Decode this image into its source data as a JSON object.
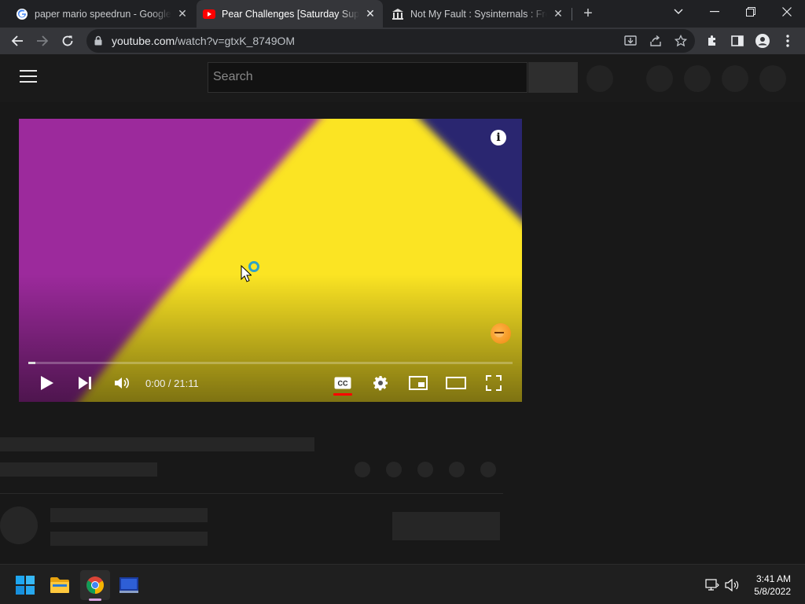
{
  "browser": {
    "tabs": [
      {
        "title": "paper mario speedrun - Google Search",
        "favicon": "google-icon",
        "active": false
      },
      {
        "title": "Pear Challenges [Saturday Supercut]",
        "favicon": "youtube-icon",
        "active": true
      },
      {
        "title": "Not My Fault : Sysinternals : Free Download",
        "favicon": "archive-icon",
        "active": false
      }
    ],
    "url_host": "youtube.com",
    "url_path": "/watch?v=gtxK_8749OM"
  },
  "youtube": {
    "search_placeholder": "Search",
    "player": {
      "timecode": "0:00 / 21:11",
      "progress_fraction": 0.015
    }
  },
  "taskbar": {
    "time": "3:41 AM",
    "date": "5/8/2022"
  },
  "colors": {
    "video_purple": "#9c2a9c",
    "video_yellow": "#fbe423",
    "video_navy": "#2b2670",
    "cc_red": "#ff0000"
  }
}
